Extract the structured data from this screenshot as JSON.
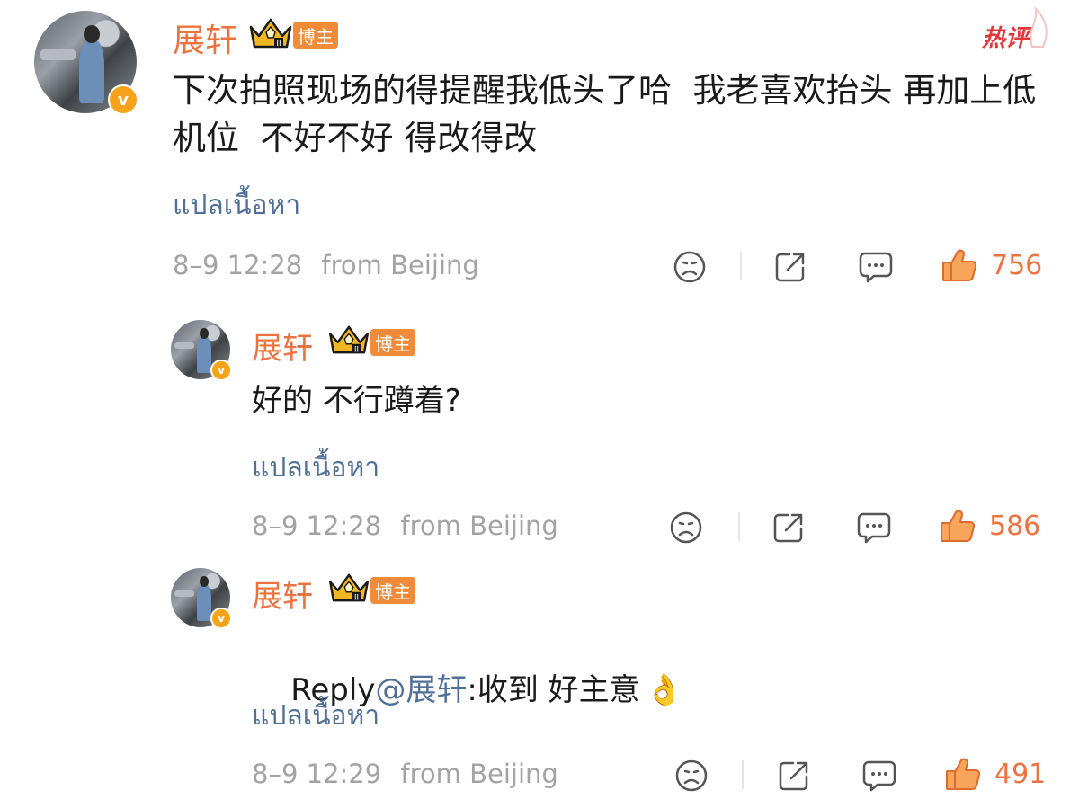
{
  "hot_label": "热评",
  "comments": [
    {
      "username": "展轩",
      "badge": "博主",
      "verified": "v",
      "text": "下次拍照现场的得提醒我低头了哈  我老喜欢抬头 再加上低机位  不好不好 得改得改",
      "translate": "แปลเนื้อหา",
      "time": "8–9 12:28",
      "location": "from Beijing",
      "likes": "756"
    },
    {
      "username": "展轩",
      "badge": "博主",
      "verified": "v",
      "text": "好的 不行蹲着?",
      "translate": "แปลเนื้อหา",
      "time": "8–9 12:28",
      "location": "from Beijing",
      "likes": "586"
    },
    {
      "username": "展轩",
      "badge": "博主",
      "verified": "v",
      "reply_prefix": "Reply",
      "mention": "@展轩",
      "text": ":收到 好主意",
      "emoji": "👌",
      "translate": "แปลเนื้อหา",
      "time": "8–9 12:29",
      "location": "from Beijing",
      "likes": "491"
    }
  ],
  "colors": {
    "username": "#eb7340",
    "badge": "#f08b3a",
    "link": "#4f6f98",
    "meta": "#a3a3a3",
    "hot": "#e0393c"
  },
  "icons": [
    "sad-face-icon",
    "share-icon",
    "comment-icon",
    "thumbs-up-icon",
    "crown-icon"
  ]
}
